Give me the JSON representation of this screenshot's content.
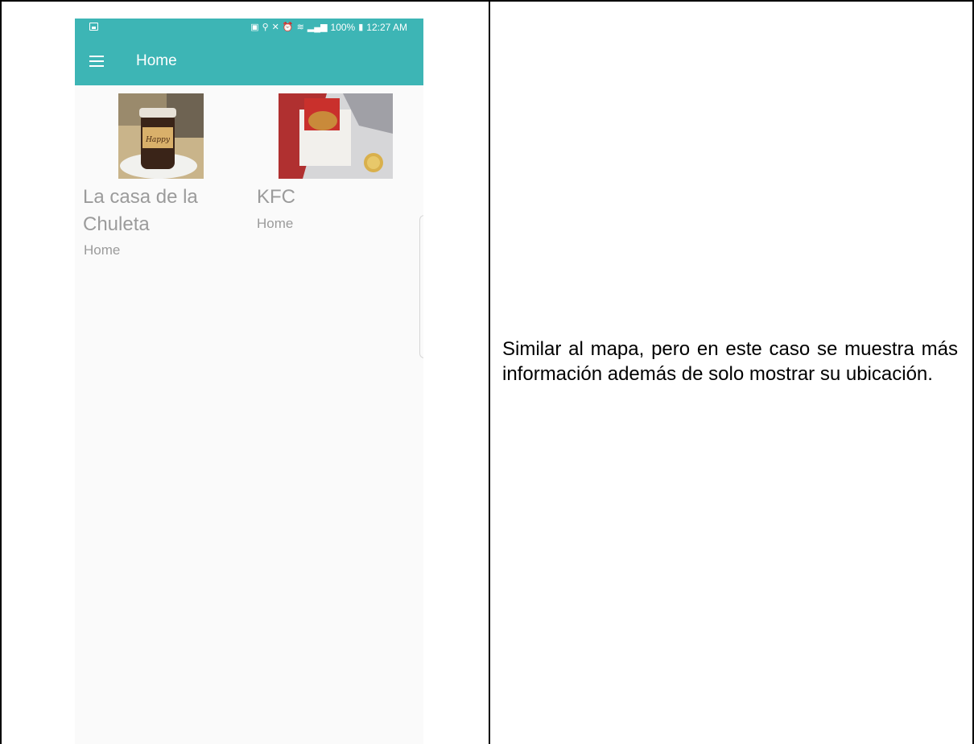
{
  "status_bar": {
    "battery": "100%",
    "time": "12:27 AM",
    "left_icon": "image-icon",
    "right_icons": [
      "sim-icon",
      "location-icon",
      "mute-icon",
      "alarm-icon",
      "wifi-icon",
      "signal-icon",
      "battery-icon"
    ]
  },
  "toolbar": {
    "title": "Home",
    "menu_icon": "hamburger-menu-icon",
    "color": "#3db5b5"
  },
  "restaurants": [
    {
      "name": "La casa de la\nChuleta",
      "category": "Home",
      "image": "jar-dessert-photo"
    },
    {
      "name": "KFC",
      "category": "Home",
      "image": "fried-chicken-box-photo"
    }
  ],
  "description": "Similar al mapa, pero en este caso se muestra más información además de solo mostrar su ubicación."
}
